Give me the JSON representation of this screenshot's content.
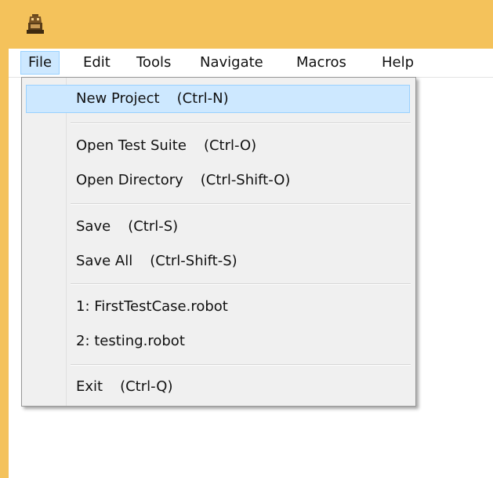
{
  "window": {
    "icon": "robot-app-icon",
    "title": ""
  },
  "menubar": {
    "items": [
      {
        "label": "File",
        "active": true
      },
      {
        "label": "Edit"
      },
      {
        "label": "Tools"
      },
      {
        "label": "Navigate"
      },
      {
        "label": "Macros"
      },
      {
        "label": "Help"
      }
    ]
  },
  "file_menu": {
    "items": [
      {
        "label": "New Project",
        "shortcut": "(Ctrl-N)",
        "highlighted": true
      },
      {
        "label": "Open Test Suite",
        "shortcut": "(Ctrl-O)"
      },
      {
        "label": "Open Directory",
        "shortcut": "(Ctrl-Shift-O)"
      },
      {
        "label": "Save",
        "shortcut": "(Ctrl-S)"
      },
      {
        "label": "Save All",
        "shortcut": "(Ctrl-Shift-S)"
      },
      {
        "label": "1: FirstTestCase.robot",
        "shortcut": ""
      },
      {
        "label": "2: testing.robot",
        "shortcut": ""
      },
      {
        "label": "Exit",
        "shortcut": "(Ctrl-Q)"
      }
    ]
  },
  "colors": {
    "titlebar": "#f4c25b",
    "highlight": "#cde8ff",
    "highlight_border": "#99d1ff",
    "menu_background": "#f0f0f0"
  }
}
